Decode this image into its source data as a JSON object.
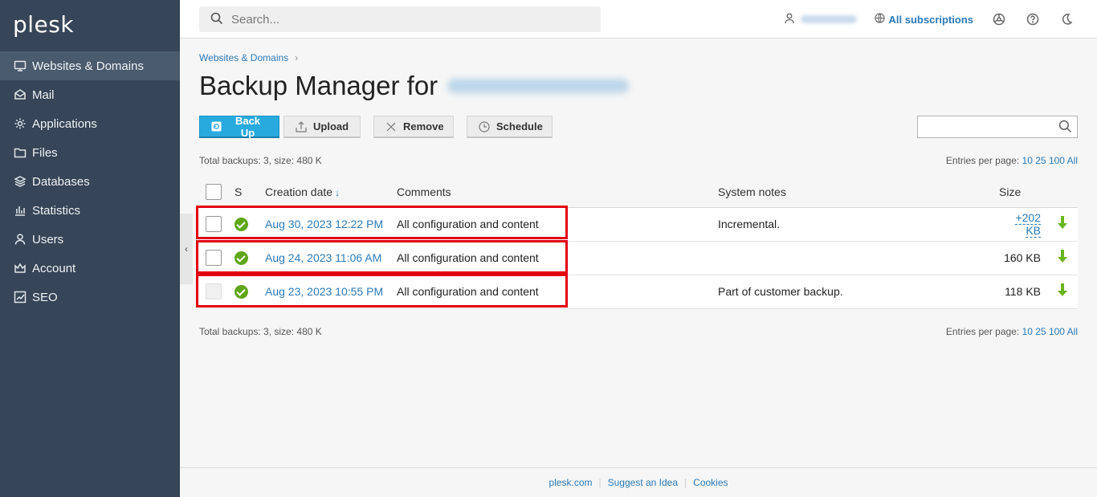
{
  "brand": {
    "logo": "plesk"
  },
  "sidebar": {
    "items": [
      {
        "label": "Websites & Domains",
        "icon": "monitor-icon",
        "active": true
      },
      {
        "label": "Mail",
        "icon": "mail-icon"
      },
      {
        "label": "Applications",
        "icon": "gear-icon"
      },
      {
        "label": "Files",
        "icon": "folder-icon"
      },
      {
        "label": "Databases",
        "icon": "layers-icon"
      },
      {
        "label": "Statistics",
        "icon": "bar-chart-icon"
      },
      {
        "label": "Users",
        "icon": "user-icon"
      },
      {
        "label": "Account",
        "icon": "crown-icon"
      },
      {
        "label": "SEO",
        "icon": "trend-icon"
      }
    ]
  },
  "header": {
    "search_placeholder": "Search...",
    "subscriptions": "All subscriptions"
  },
  "breadcrumb": {
    "item": "Websites & Domains"
  },
  "page": {
    "title": "Backup Manager for"
  },
  "toolbar": {
    "backup": "Back Up",
    "upload": "Upload",
    "remove": "Remove",
    "schedule": "Schedule"
  },
  "summary": {
    "total": "Total backups: 3, size: 480 K",
    "entries_label": "Entries per page:",
    "options": [
      "10",
      "25",
      "100",
      "All"
    ]
  },
  "table": {
    "headers": {
      "s": "S",
      "date": "Creation date",
      "comments": "Comments",
      "notes": "System notes",
      "size": "Size"
    },
    "rows": [
      {
        "date": "Aug 30, 2023 12:22 PM",
        "comments": "All configuration and content",
        "notes": "Incremental.",
        "size": "+202 KB",
        "size_link": true
      },
      {
        "date": "Aug 24, 2023 11:06 AM",
        "comments": "All configuration and content",
        "notes": "",
        "size": "160 KB",
        "size_link": false
      },
      {
        "date": "Aug 23, 2023 10:55 PM",
        "comments": "All configuration and content",
        "notes": "Part of customer backup.",
        "size": "118 KB",
        "size_link": false
      }
    ]
  },
  "footer": {
    "links": [
      "plesk.com",
      "Suggest an Idea",
      "Cookies"
    ]
  },
  "colors": {
    "sidebar": "#364557",
    "accent": "#28aade",
    "link": "#2b7ab8",
    "ok": "#5fa718",
    "highlight": "#e3000f"
  }
}
